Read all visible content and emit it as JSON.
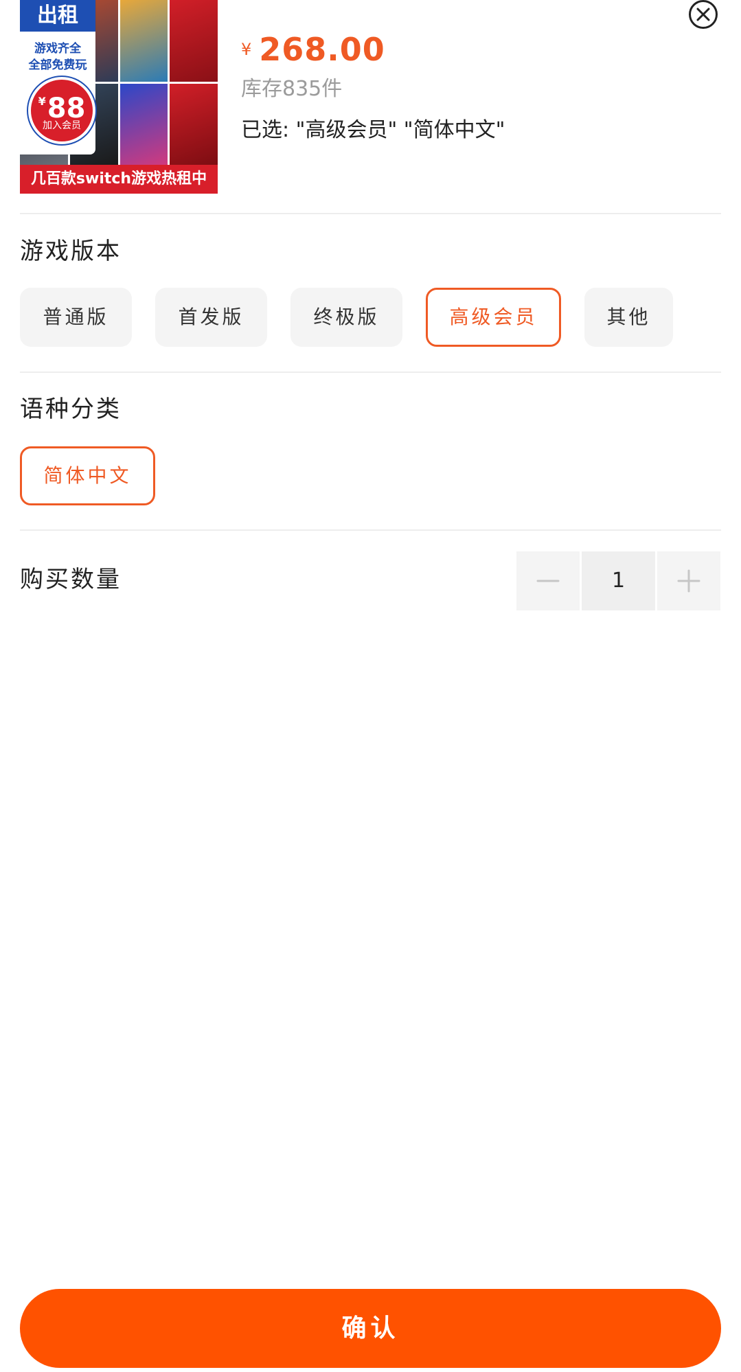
{
  "product": {
    "image_badge_top": "出租",
    "image_badge_line1": "游戏齐全",
    "image_badge_line2": "全部免费玩",
    "image_badge_price": "88",
    "image_badge_currency": "¥",
    "image_badge_join": "加入会员",
    "image_banner": "几百款switch游戏热租中",
    "price_currency": "¥",
    "price": "268.00",
    "stock": "库存835件",
    "selected_text": "已选: \"高级会员\" \"简体中文\""
  },
  "sections": {
    "game_version_title": "游戏版本",
    "language_title": "语种分类",
    "quantity_title": "购买数量"
  },
  "game_versions": [
    {
      "label": "普通版",
      "selected": false
    },
    {
      "label": "首发版",
      "selected": false
    },
    {
      "label": "终极版",
      "selected": false
    },
    {
      "label": "高级会员",
      "selected": true
    },
    {
      "label": "其他",
      "selected": false
    }
  ],
  "languages": [
    {
      "label": "简体中文",
      "selected": true
    }
  ],
  "quantity": {
    "value": "1"
  },
  "footer": {
    "confirm_label": "确认"
  },
  "colors": {
    "accent": "#ef5a24",
    "confirm_button": "#ff5200",
    "chip_bg": "#f4f4f4"
  },
  "icons": {
    "close": "close-icon",
    "minus": "minus-icon",
    "plus": "plus-icon"
  }
}
